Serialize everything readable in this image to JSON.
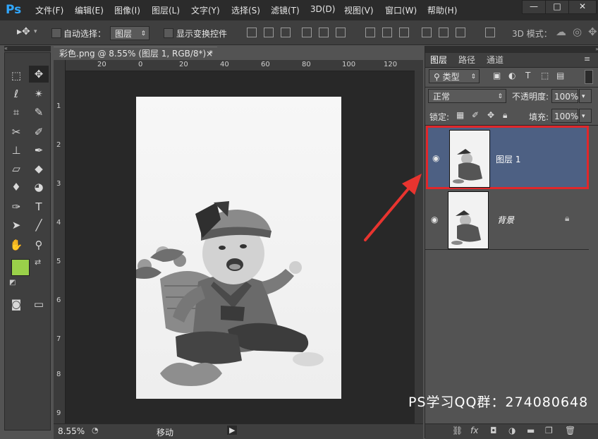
{
  "menubar": {
    "logo": "Ps",
    "items": [
      "文件(F)",
      "编辑(E)",
      "图像(I)",
      "图层(L)",
      "文字(Y)",
      "选择(S)",
      "滤镜(T)",
      "3D(D)",
      "视图(V)",
      "窗口(W)",
      "帮助(H)"
    ],
    "window_buttons": [
      "—",
      "□",
      "✕"
    ]
  },
  "options": {
    "auto_select_label": "自动选择：",
    "auto_select_value": "图层",
    "show_transform_label": "显示变换控件",
    "mode_label": "3D 模式："
  },
  "document": {
    "tab_title": "彩色.png @ 8.55% (图层 1, RGB/8*) *",
    "tab_close": "×",
    "ruler_top": [
      "20",
      "0",
      "20",
      "40",
      "60",
      "80",
      "100",
      "120"
    ],
    "ruler_left": [
      "1",
      "2",
      "3",
      "4",
      "5",
      "6",
      "7",
      "8",
      "9"
    ],
    "zoom": "8.55%",
    "status_text": "移动"
  },
  "layers_panel": {
    "tabs": [
      "图层",
      "路径",
      "通道"
    ],
    "filter_kind": "类型",
    "blend_mode": "正常",
    "opacity_label": "不透明度:",
    "opacity_value": "100%",
    "lock_label": "锁定:",
    "fill_label": "填充:",
    "fill_value": "100%",
    "layers": [
      {
        "name": "图层 1",
        "selected": true
      },
      {
        "name": "背景",
        "selected": false,
        "locked": true
      }
    ]
  },
  "watermark": "PS学习QQ群：274080648",
  "colors": {
    "foreground": "#9ad14a",
    "background": "#ffffff",
    "selection": "#4d6083",
    "highlight_border": "#e0272b",
    "arrow": "#e8342f"
  }
}
